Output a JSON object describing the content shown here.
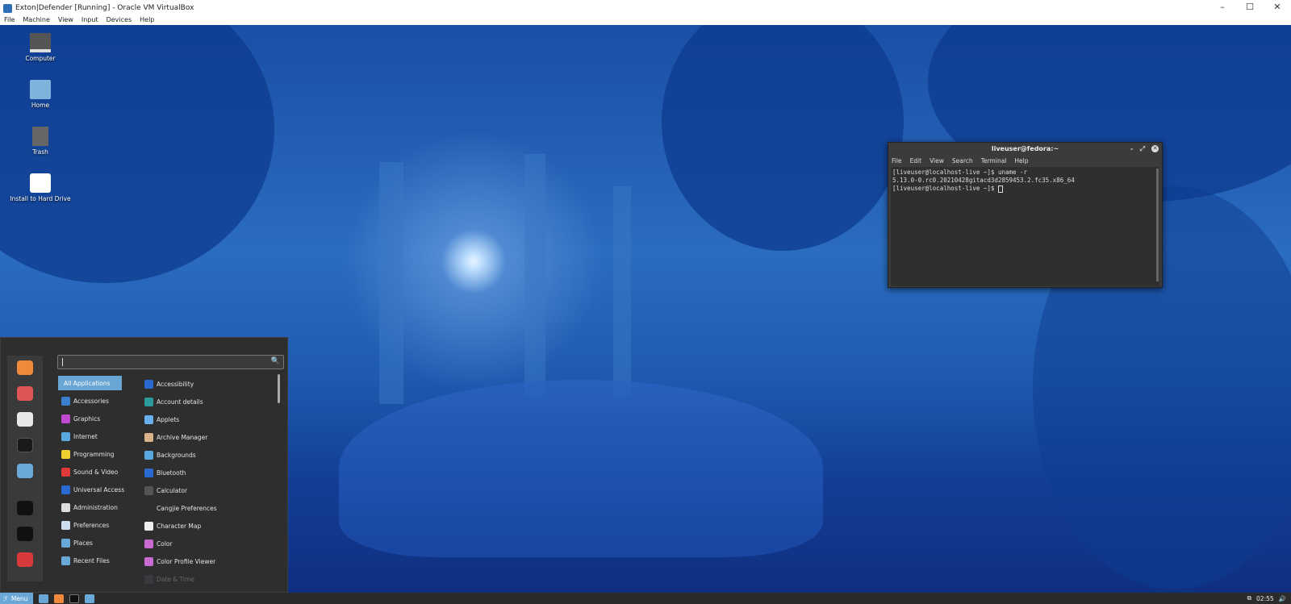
{
  "window": {
    "title": "Exton|Defender [Running] - Oracle VM VirtualBox",
    "controls": [
      "–",
      "☐",
      "✕"
    ]
  },
  "vbox_menu": [
    "File",
    "Machine",
    "View",
    "Input",
    "Devices",
    "Help"
  ],
  "desktop_icons": [
    {
      "label": "Computer"
    },
    {
      "label": "Home"
    },
    {
      "label": "Trash"
    },
    {
      "label": "Install to Hard Drive"
    }
  ],
  "terminal": {
    "title": "liveuser@fedora:~",
    "controls": [
      "–",
      "⤢",
      "✕"
    ],
    "menu": [
      "File",
      "Edit",
      "View",
      "Search",
      "Terminal",
      "Help"
    ],
    "lines": [
      "[liveuser@localhost-live ~]$ uname -r",
      "5.13.0-0.rc0.20210428gitacd3d2859453.2.fc35.x86_64",
      "[liveuser@localhost-live ~]$ "
    ]
  },
  "menu": {
    "search_value": "",
    "search_icon": "🔍",
    "categories": [
      "All Applications",
      "Accessories",
      "Graphics",
      "Internet",
      "Programming",
      "Sound & Video",
      "Universal Access",
      "Administration",
      "Preferences",
      "Places",
      "Recent Files"
    ],
    "apps": [
      "Accessibility",
      "Account details",
      "Applets",
      "Archive Manager",
      "Backgrounds",
      "Bluetooth",
      "Calculator",
      "Cangjie Preferences",
      "Character Map",
      "Color",
      "Color Profile Viewer",
      "Date & Time"
    ],
    "favorites": [
      "firefox",
      "software",
      "settings",
      "terminal",
      "files"
    ],
    "session": [
      "lock",
      "logout",
      "shutdown"
    ]
  },
  "taskbar": {
    "menu_label": "Menu",
    "clock": "02:55"
  },
  "colors": {
    "accent": "#69a6d4",
    "panel": "#2e2e2e"
  }
}
